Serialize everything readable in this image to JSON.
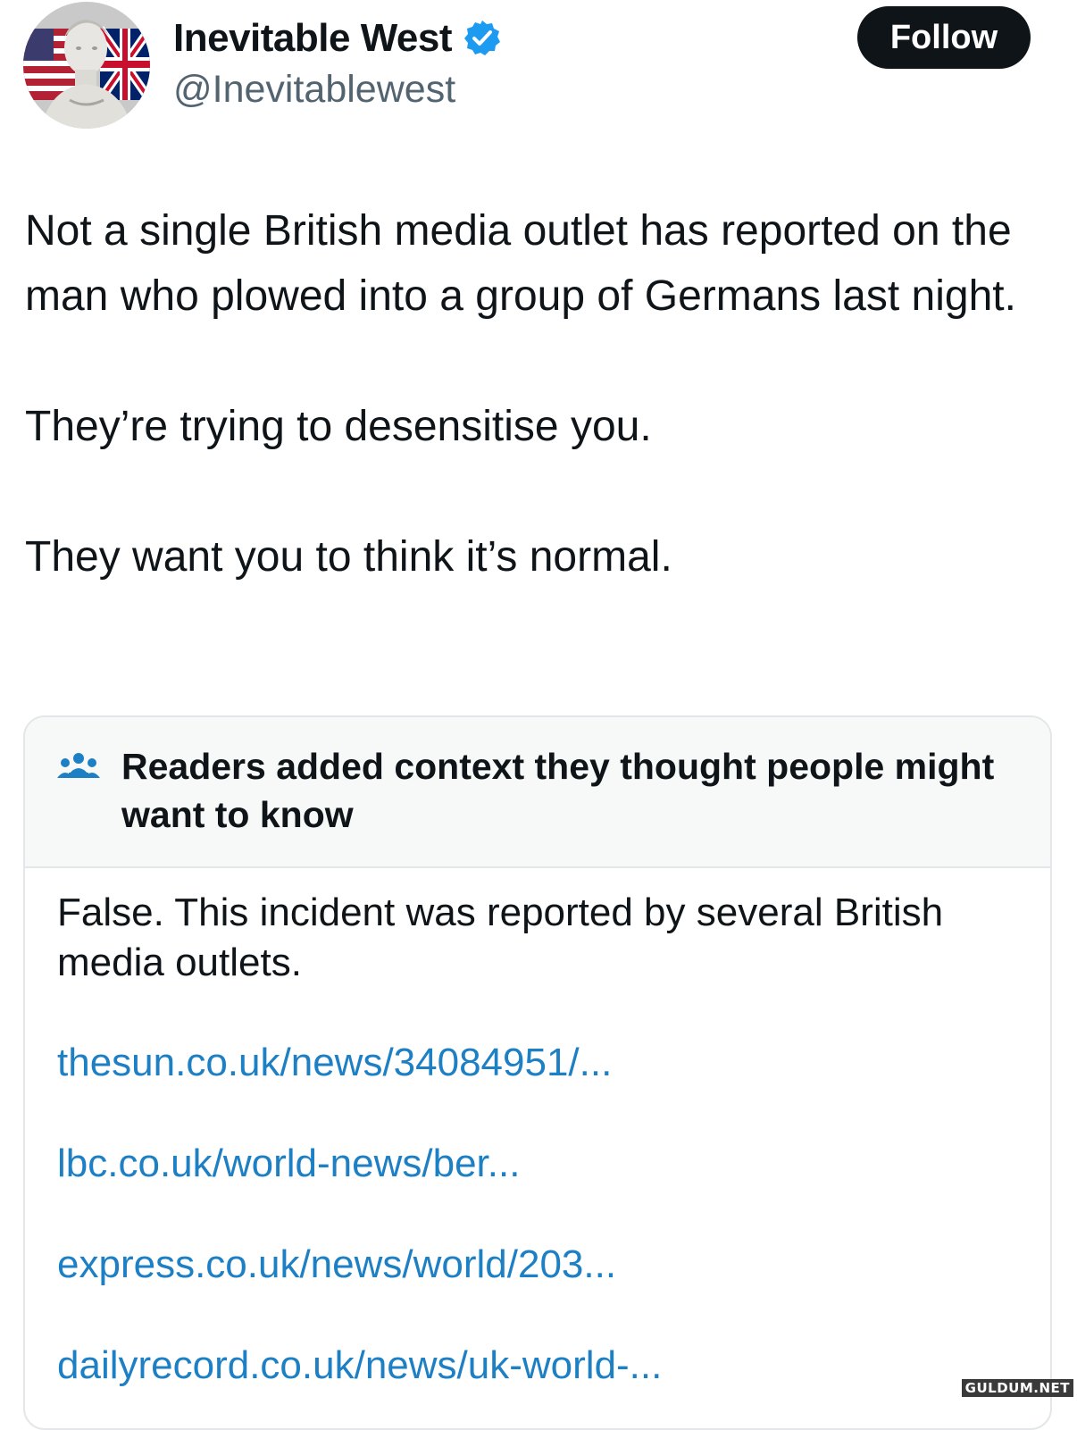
{
  "author": {
    "display_name": "Inevitable West",
    "handle": "@Inevitablewest",
    "verified": true,
    "avatar_icon": "statue-with-flags-avatar"
  },
  "follow_button": {
    "label": "Follow"
  },
  "tweet": {
    "paragraphs": [
      "Not a single British media outlet has reported on the man who plowed into a group of Germans last night.",
      "They’re trying to desensitise you.",
      "They want you to think it’s normal."
    ]
  },
  "community_note": {
    "icon": "people-icon",
    "title": "Readers added context they thought people might want to know",
    "text": "False. This incident was reported by several British media outlets.",
    "links": [
      "thesun.co.uk/news/34084951/...",
      "lbc.co.uk/world-news/ber...",
      "express.co.uk/news/world/203...",
      "dailyrecord.co.uk/news/uk-world-..."
    ]
  },
  "watermark": "GULDUM.NET",
  "colors": {
    "text": "#0f1419",
    "secondary_text": "#536471",
    "link": "#1d7fc4",
    "verified_badge": "#1d9bf0",
    "follow_button_bg": "#0f1419",
    "note_header_bg": "#f7f9f9"
  }
}
